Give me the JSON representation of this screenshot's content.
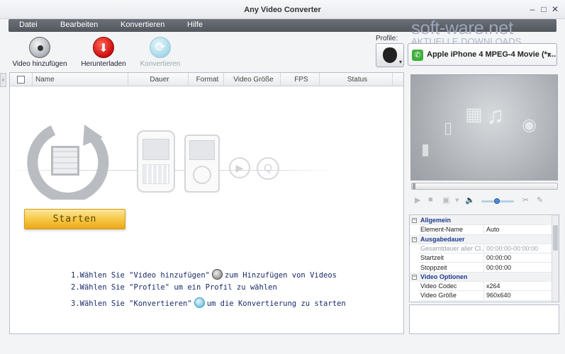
{
  "window": {
    "title": "Any Video Converter"
  },
  "menu": [
    "Datei",
    "Bearbeiten",
    "Konvertieren",
    "Hilfe"
  ],
  "watermark": {
    "brand": "soft-ware.net",
    "tagline": "AKTUELLE DOWNLOADS"
  },
  "toolbar": {
    "add_video": "Video hinzufügen",
    "download": "Herunterladen",
    "convert": "Konvertieren"
  },
  "profile": {
    "label": "Profile:",
    "selected": "Apple iPhone 4 MPEG-4 Movie (*...."
  },
  "filelist": {
    "columns": [
      "Name",
      "Dauer",
      "Format",
      "Video Größe",
      "FPS",
      "Status"
    ]
  },
  "start_button": "Starten",
  "instructions": {
    "line1_a": "1.Wählen Sie \"Video hinzufügen\"",
    "line1_b": "zum Hinzufügen von Videos",
    "line2": "2.Wählen Sie \"Profile\" um ein Profil zu wählen",
    "line3_a": "3.Wählen Sie \"Konvertieren\"",
    "line3_b": "um die Konvertierung zu starten"
  },
  "properties": [
    {
      "type": "category",
      "label": "Allgemein"
    },
    {
      "type": "row",
      "key": "Element-Name",
      "value": "Auto"
    },
    {
      "type": "category",
      "label": "Ausgabedauer"
    },
    {
      "type": "row",
      "key": "Gesamtdauer aller Cl...",
      "value": "00:00:00-00:00:00",
      "disabled": true
    },
    {
      "type": "row",
      "key": "Startzeit",
      "value": "00:00:00"
    },
    {
      "type": "row",
      "key": "Stoppzeit",
      "value": "00:00:00"
    },
    {
      "type": "category",
      "label": "Video Optionen"
    },
    {
      "type": "row",
      "key": "Video Codec",
      "value": "x264"
    },
    {
      "type": "row",
      "key": "Video Größe",
      "value": "960x640"
    }
  ],
  "colors": {
    "menubar": "#5e626a",
    "start": "#f6c540",
    "category": "#1e3a8a"
  }
}
